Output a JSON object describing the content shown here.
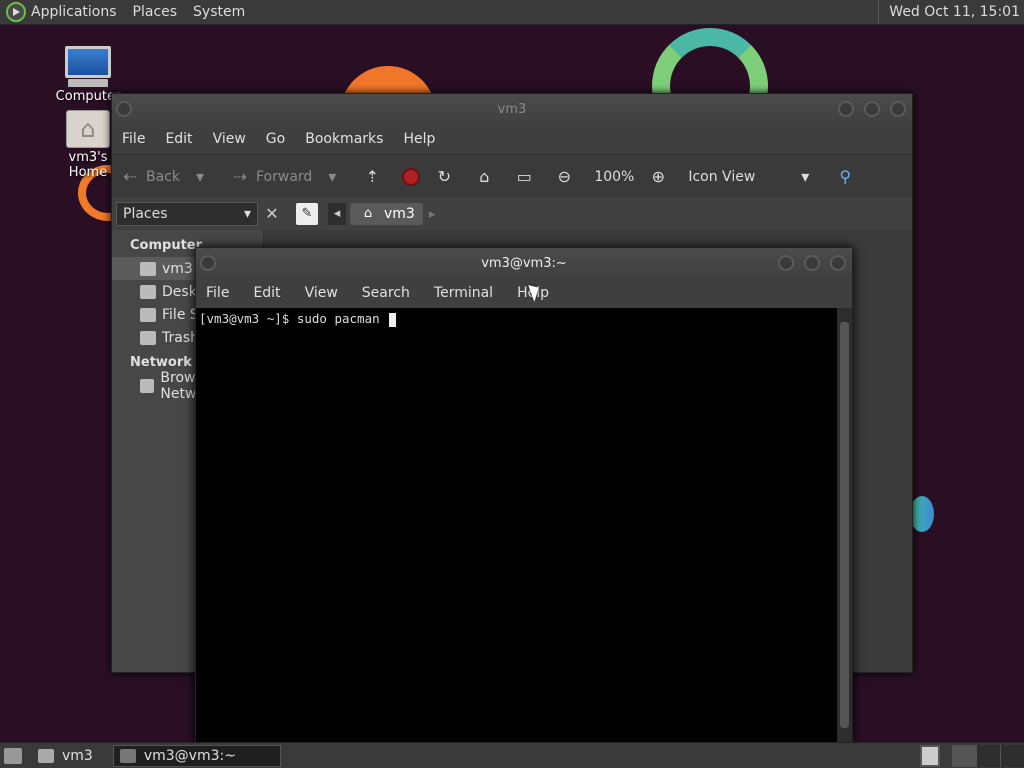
{
  "top_panel": {
    "menus": [
      "Applications",
      "Places",
      "System"
    ],
    "clock": "Wed Oct 11, 15:01"
  },
  "desktop": {
    "icons": [
      {
        "label": "Computer"
      },
      {
        "label": "vm3's Home"
      }
    ]
  },
  "file_manager": {
    "title": "vm3",
    "menu": [
      "File",
      "Edit",
      "View",
      "Go",
      "Bookmarks",
      "Help"
    ],
    "toolbar": {
      "back": "Back",
      "forward": "Forward",
      "zoom": "100%",
      "view_mode": "Icon View"
    },
    "places_select": "Places",
    "breadcrumb": "vm3",
    "sidebar": {
      "computer_header": "Computer",
      "computer_items": [
        "vm3",
        "Desktop",
        "File System",
        "Trash"
      ],
      "network_header": "Network",
      "network_items": [
        "Browse Network"
      ]
    }
  },
  "terminal": {
    "title": "vm3@vm3:~",
    "menu": [
      "File",
      "Edit",
      "View",
      "Search",
      "Terminal",
      "Help"
    ],
    "prompt_line": "[vm3@vm3 ~]$ sudo pacman "
  },
  "taskbar": {
    "tasks": [
      {
        "label": "vm3",
        "active": false
      },
      {
        "label": "vm3@vm3:~",
        "active": true
      }
    ]
  }
}
